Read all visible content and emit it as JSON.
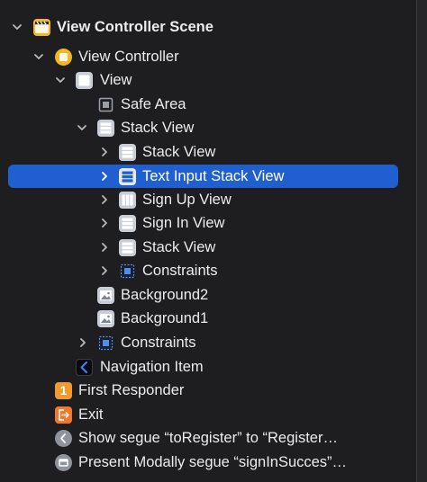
{
  "outline": {
    "scene": {
      "label": "View Controller Scene",
      "icon": "scene-clapper-icon"
    },
    "view_controller": {
      "label": "View Controller",
      "icon": "view-controller-icon"
    },
    "view": {
      "label": "View",
      "icon": "view-icon"
    },
    "safe_area": {
      "label": "Safe Area",
      "icon": "safe-area-icon"
    },
    "stack_view_main": {
      "label": "Stack View",
      "icon": "vertical-stack-icon"
    },
    "stack_view_1": {
      "label": "Stack View",
      "icon": "vertical-stack-icon"
    },
    "text_input_stack": {
      "label": "Text Input Stack View",
      "icon": "vertical-stack-icon"
    },
    "sign_up_view": {
      "label": "Sign Up View",
      "icon": "horizontal-stack-icon"
    },
    "sign_in_view": {
      "label": "Sign In View",
      "icon": "vertical-stack-icon"
    },
    "stack_view_2": {
      "label": "Stack View",
      "icon": "vertical-stack-icon"
    },
    "constraints_inner": {
      "label": "Constraints",
      "icon": "constraints-icon"
    },
    "background2": {
      "label": "Background2",
      "icon": "image-view-icon"
    },
    "background1": {
      "label": "Background1",
      "icon": "image-view-icon"
    },
    "constraints_outer": {
      "label": "Constraints",
      "icon": "constraints-icon"
    },
    "navigation_item": {
      "label": "Navigation Item",
      "icon": "navigation-item-icon"
    },
    "first_responder": {
      "label": "First Responder",
      "icon": "first-responder-icon",
      "glyph": "1"
    },
    "exit": {
      "label": "Exit",
      "icon": "exit-icon"
    },
    "segue_register": {
      "label": "Show segue “toRegister” to “Register…",
      "icon": "show-segue-icon"
    },
    "segue_signin": {
      "label": "Present Modally segue “signInSucces”…",
      "icon": "modal-segue-icon"
    }
  },
  "colors": {
    "background": "#1e1e20",
    "selection": "#1f5fcf",
    "text": "#ececec",
    "icon_gray": "#c8cdd6",
    "accent_orange": "#f29a2e",
    "accent_yellow": "#f5b623"
  }
}
